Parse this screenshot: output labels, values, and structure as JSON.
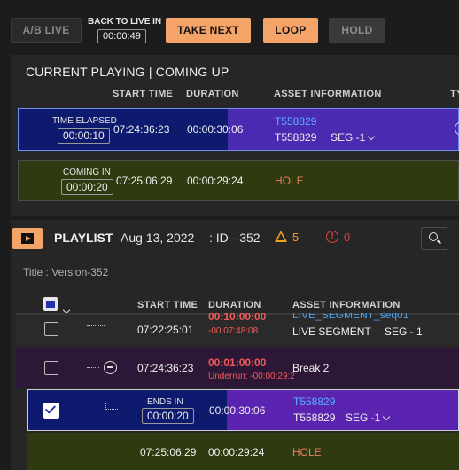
{
  "topbar": {
    "ab_live_label": "A/B LIVE",
    "back_to_live_label": "BACK TO LIVE IN",
    "back_to_live_timer": "00:00:49",
    "take_next_label": "TAKE NEXT",
    "loop_label": "LOOP",
    "hold_label": "HOLD"
  },
  "current": {
    "title": "CURRENT PLAYING | COMING UP",
    "columns": {
      "start_time": "START TIME",
      "duration": "DURATION",
      "asset_info": "ASSET INFORMATION",
      "type_partial": "TY"
    },
    "playing": {
      "elapsed_label": "TIME ELAPSED",
      "elapsed_timer": "00:00:10",
      "start_time": "07:24:36:23",
      "duration": "00:00:30:06",
      "asset_id_link": "T558829",
      "asset_id": "T558829",
      "segment": "SEG -1"
    },
    "coming": {
      "coming_label": "COMING IN",
      "coming_timer": "00:00:20",
      "start_time": "07:25:06:29",
      "duration": "00:00:29:24",
      "asset": "HOLE"
    }
  },
  "playlist": {
    "title": "PLAYLIST",
    "date": "Aug 13, 2022",
    "id_label": ": ID - 352",
    "warning_count": "5",
    "error_count": "0",
    "subtitle": "Title : Version-352",
    "columns": {
      "start_time": "START TIME",
      "duration": "DURATION",
      "asset_info": "ASSET INFORMATION"
    },
    "rows": [
      {
        "start_time": "07:22:25:01",
        "duration_top": "00:10:00:00",
        "duration_sub": "-00:07:48:08",
        "asset_top": "LIVE_SEGMENT_seq01",
        "asset_name": "LIVE SEGMENT",
        "segment": "SEG - 1"
      },
      {
        "start_time": "07:24:36:23",
        "duration": "00:01:00:00",
        "underrun": "Underrun: -00:00:29:24",
        "asset_name": "Break 2"
      },
      {
        "ends_label": "ENDS IN",
        "ends_timer": "00:00:20",
        "duration": "00:00:30:06",
        "asset_id_link": "T558829",
        "asset_id": "T558829",
        "segment": "SEG -1"
      },
      {
        "start_time": "07:25:06:29",
        "duration": "00:00:29:24",
        "asset": "HOLE"
      }
    ]
  },
  "colors": {
    "accent_orange": "#f5a469",
    "playing_blue": "#0d1a6e",
    "coming_olive": "#2e3a0f",
    "playlist_purple": "#5a24b0",
    "warning": "#f0a020",
    "error": "#e0403f",
    "link_blue": "#4aa3f0",
    "red_duration": "#f05a5a"
  }
}
